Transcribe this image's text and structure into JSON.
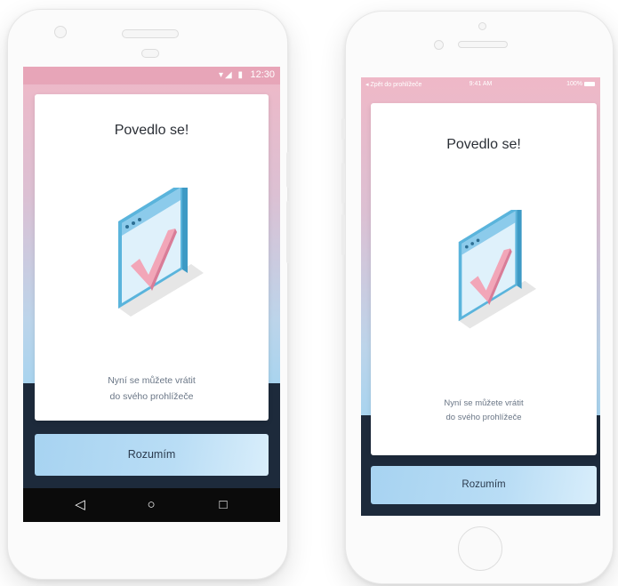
{
  "android": {
    "status_bar": {
      "time": "12:30",
      "icons": "▾◢ ▮"
    },
    "card": {
      "title": "Povedlo se!",
      "message_line1": "Nyní se můžete vrátit",
      "message_line2": "do svého prohlížeče"
    },
    "cta_label": "Rozumím",
    "nav": {
      "back": "◁",
      "home": "○",
      "recents": "□"
    }
  },
  "iphone": {
    "status_bar": {
      "back": "◂ Zpět do prohlížeče",
      "time": "9:41 AM",
      "battery": "100%"
    },
    "card": {
      "title": "Povedlo se!",
      "message_line1": "Nyní se můžete vrátit",
      "message_line2": "do svého prohlížeče"
    },
    "cta_label": "Rozumím"
  },
  "colors": {
    "gradient_top": "#efb8c7",
    "gradient_bottom": "#a9d4ef",
    "dark_band": "#1d2a3b",
    "button": "#b9ddf5",
    "check": "#f2a6b8"
  }
}
